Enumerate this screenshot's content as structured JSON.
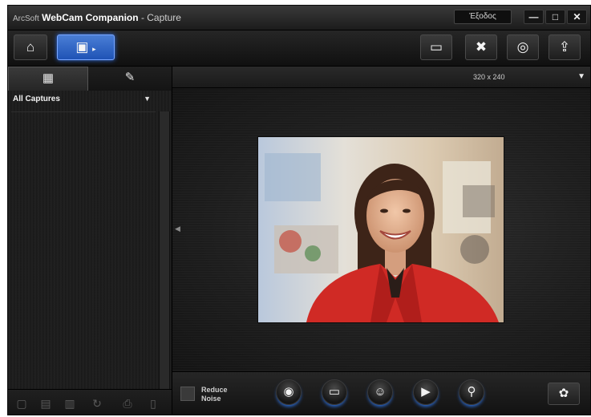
{
  "window": {
    "brand": "ArcSoft",
    "product": "WebCam Companion",
    "title_suffix": "- Capture",
    "exit_label": "Έξοδος",
    "minimize_glyph": "—",
    "maximize_glyph": "□",
    "close_glyph": "✕"
  },
  "toolbar": {
    "left": [
      {
        "name": "home-icon",
        "glyph": "⌂"
      },
      {
        "name": "capture-mode-icon",
        "glyph": "▣",
        "active": true
      }
    ],
    "right": [
      {
        "name": "monitor-icon",
        "glyph": "▭"
      },
      {
        "name": "tools-icon",
        "glyph": "✖"
      },
      {
        "name": "webcam-search-icon",
        "glyph": "◎"
      },
      {
        "name": "upload-icon",
        "glyph": "⇪"
      }
    ]
  },
  "left_panel": {
    "tabs": [
      {
        "name": "tab-folders",
        "glyph": "▦",
        "active": true
      },
      {
        "name": "tab-edit",
        "glyph": "✎",
        "active": false
      }
    ],
    "filter_label": "All Captures",
    "bottom_icons": [
      {
        "name": "import-icon",
        "glyph": "▢"
      },
      {
        "name": "folder-icon",
        "glyph": "▤"
      },
      {
        "name": "slideshow-icon",
        "glyph": "▥"
      },
      {
        "name": "rotate-icon",
        "glyph": "↻"
      },
      {
        "name": "print-icon",
        "glyph": "⎙"
      },
      {
        "name": "delete-icon",
        "glyph": "▯"
      }
    ]
  },
  "preview": {
    "resolution": "320 x 240"
  },
  "bottom_bar": {
    "reduce_noise_label": "Reduce Noise",
    "controls": [
      {
        "name": "snapshot-camera-icon",
        "glyph": "◉"
      },
      {
        "name": "record-screen-icon",
        "glyph": "▭"
      },
      {
        "name": "face-tracking-icon",
        "glyph": "☺"
      },
      {
        "name": "video-record-icon",
        "glyph": "▶"
      },
      {
        "name": "zoom-icon",
        "glyph": "⚲"
      }
    ],
    "effects_glyph": "✿"
  }
}
